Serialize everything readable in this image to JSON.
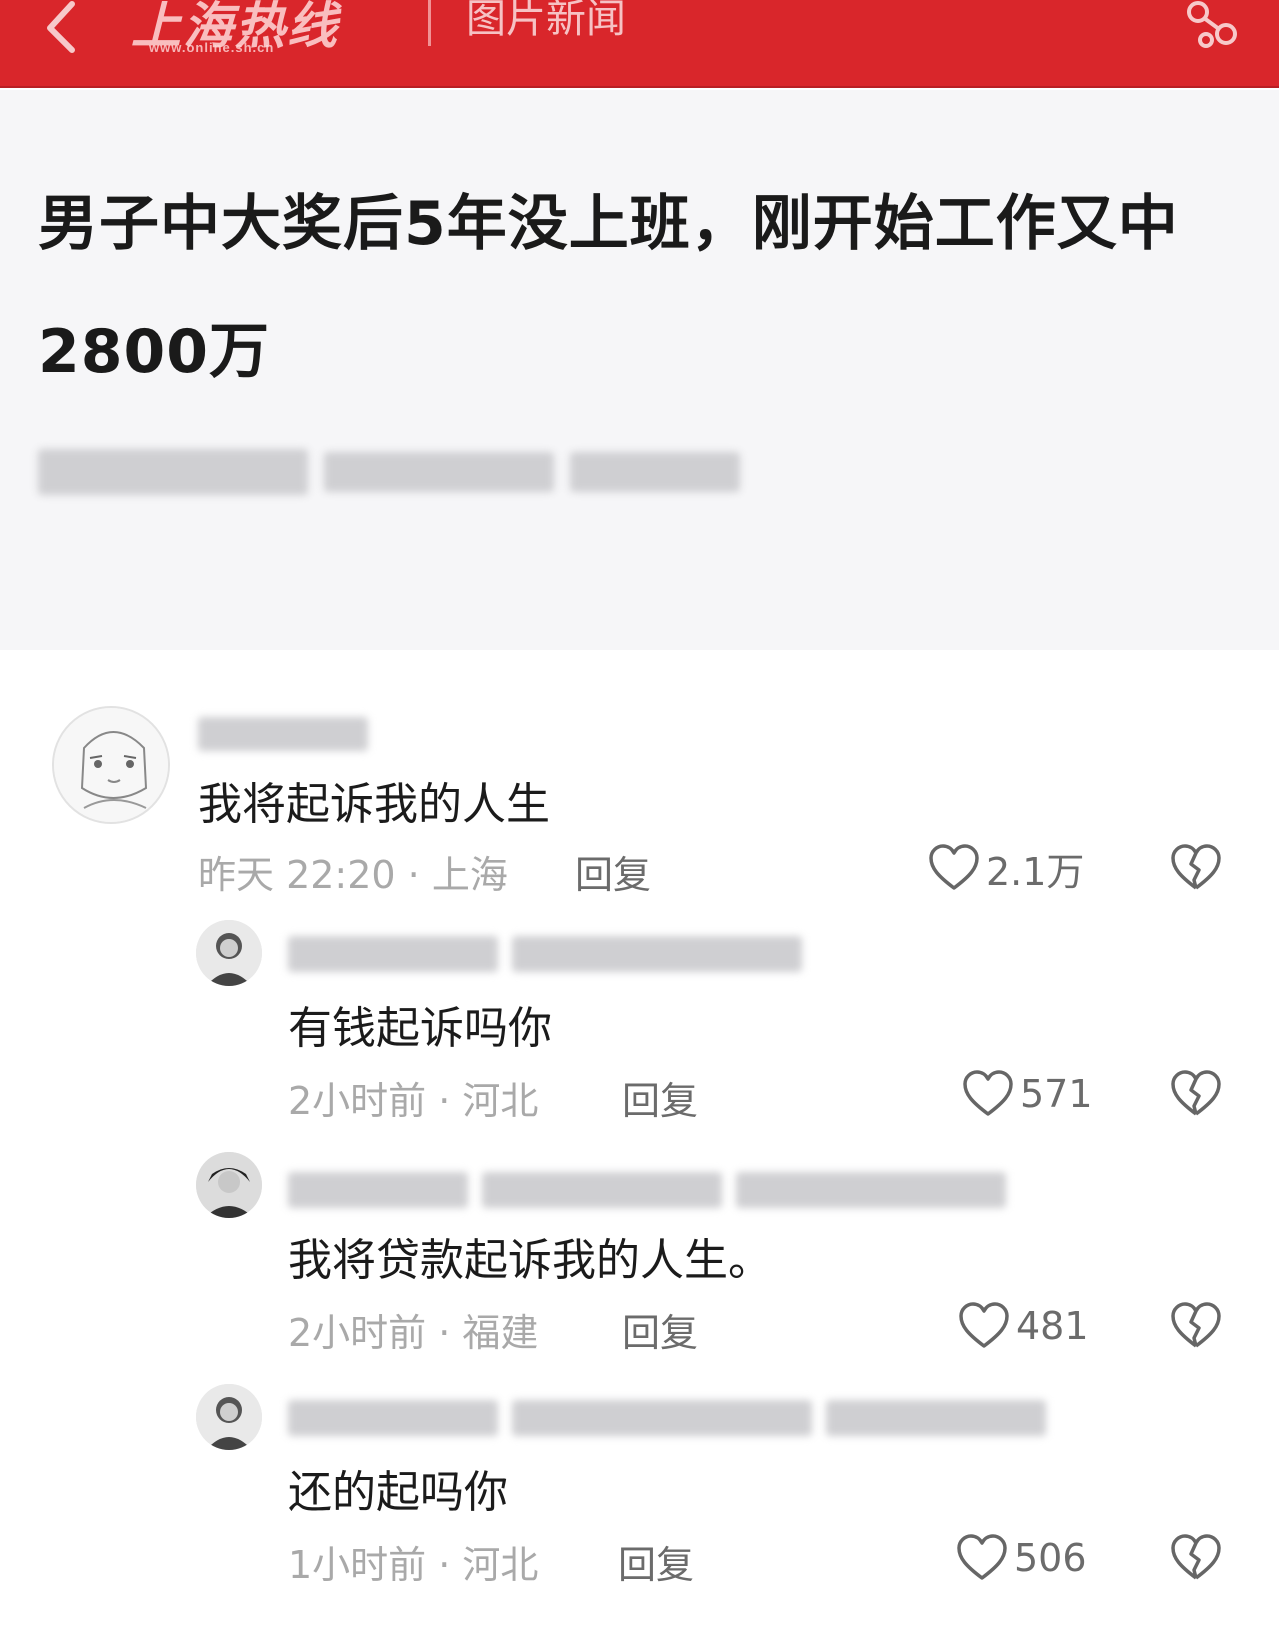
{
  "header": {
    "logo_text": "上海热线",
    "logo_url": "www.online.sh.cn",
    "section_title": "图片新闻",
    "back_icon": "chevron-left-icon",
    "share_icon": "share-icon",
    "bg_color": "#d9262b"
  },
  "article": {
    "title": "男子中大奖后5年没上班，刚开始工作又中2800万"
  },
  "comments": [
    {
      "text": "我将起诉我的人生",
      "meta": "昨天 22:20 · 上海",
      "reply_label": "回复",
      "likes": "2.1万"
    },
    {
      "text": "有钱起诉吗你",
      "meta": "2小时前 · 河北",
      "reply_label": "回复",
      "likes": "571"
    },
    {
      "text": "我将贷款起诉我的人生。",
      "meta": "2小时前 · 福建",
      "reply_label": "回复",
      "likes": "481"
    },
    {
      "text": "还的起吗你",
      "meta": "1小时前 · 河北",
      "reply_label": "回复",
      "likes": "506"
    }
  ],
  "icons": {
    "like": "heart-icon",
    "dislike": "broken-heart-icon"
  }
}
